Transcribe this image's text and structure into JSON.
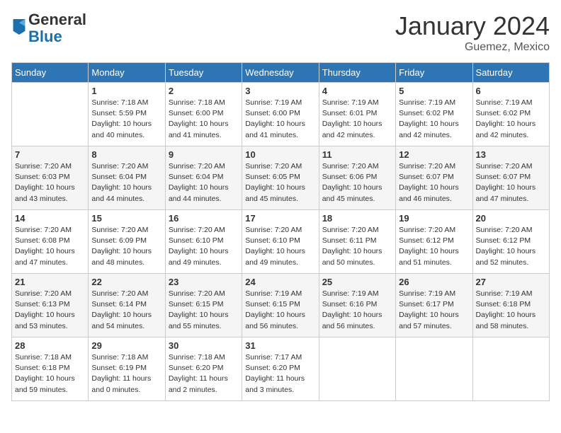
{
  "logo": {
    "general": "General",
    "blue": "Blue"
  },
  "header": {
    "month": "January 2024",
    "location": "Guemez, Mexico"
  },
  "weekdays": [
    "Sunday",
    "Monday",
    "Tuesday",
    "Wednesday",
    "Thursday",
    "Friday",
    "Saturday"
  ],
  "weeks": [
    [
      {
        "day": "",
        "detail": ""
      },
      {
        "day": "1",
        "detail": "Sunrise: 7:18 AM\nSunset: 5:59 PM\nDaylight: 10 hours\nand 40 minutes."
      },
      {
        "day": "2",
        "detail": "Sunrise: 7:18 AM\nSunset: 6:00 PM\nDaylight: 10 hours\nand 41 minutes."
      },
      {
        "day": "3",
        "detail": "Sunrise: 7:19 AM\nSunset: 6:00 PM\nDaylight: 10 hours\nand 41 minutes."
      },
      {
        "day": "4",
        "detail": "Sunrise: 7:19 AM\nSunset: 6:01 PM\nDaylight: 10 hours\nand 42 minutes."
      },
      {
        "day": "5",
        "detail": "Sunrise: 7:19 AM\nSunset: 6:02 PM\nDaylight: 10 hours\nand 42 minutes."
      },
      {
        "day": "6",
        "detail": "Sunrise: 7:19 AM\nSunset: 6:02 PM\nDaylight: 10 hours\nand 42 minutes."
      }
    ],
    [
      {
        "day": "7",
        "detail": "Sunrise: 7:20 AM\nSunset: 6:03 PM\nDaylight: 10 hours\nand 43 minutes."
      },
      {
        "day": "8",
        "detail": "Sunrise: 7:20 AM\nSunset: 6:04 PM\nDaylight: 10 hours\nand 44 minutes."
      },
      {
        "day": "9",
        "detail": "Sunrise: 7:20 AM\nSunset: 6:04 PM\nDaylight: 10 hours\nand 44 minutes."
      },
      {
        "day": "10",
        "detail": "Sunrise: 7:20 AM\nSunset: 6:05 PM\nDaylight: 10 hours\nand 45 minutes."
      },
      {
        "day": "11",
        "detail": "Sunrise: 7:20 AM\nSunset: 6:06 PM\nDaylight: 10 hours\nand 45 minutes."
      },
      {
        "day": "12",
        "detail": "Sunrise: 7:20 AM\nSunset: 6:07 PM\nDaylight: 10 hours\nand 46 minutes."
      },
      {
        "day": "13",
        "detail": "Sunrise: 7:20 AM\nSunset: 6:07 PM\nDaylight: 10 hours\nand 47 minutes."
      }
    ],
    [
      {
        "day": "14",
        "detail": "Sunrise: 7:20 AM\nSunset: 6:08 PM\nDaylight: 10 hours\nand 47 minutes."
      },
      {
        "day": "15",
        "detail": "Sunrise: 7:20 AM\nSunset: 6:09 PM\nDaylight: 10 hours\nand 48 minutes."
      },
      {
        "day": "16",
        "detail": "Sunrise: 7:20 AM\nSunset: 6:10 PM\nDaylight: 10 hours\nand 49 minutes."
      },
      {
        "day": "17",
        "detail": "Sunrise: 7:20 AM\nSunset: 6:10 PM\nDaylight: 10 hours\nand 49 minutes."
      },
      {
        "day": "18",
        "detail": "Sunrise: 7:20 AM\nSunset: 6:11 PM\nDaylight: 10 hours\nand 50 minutes."
      },
      {
        "day": "19",
        "detail": "Sunrise: 7:20 AM\nSunset: 6:12 PM\nDaylight: 10 hours\nand 51 minutes."
      },
      {
        "day": "20",
        "detail": "Sunrise: 7:20 AM\nSunset: 6:12 PM\nDaylight: 10 hours\nand 52 minutes."
      }
    ],
    [
      {
        "day": "21",
        "detail": "Sunrise: 7:20 AM\nSunset: 6:13 PM\nDaylight: 10 hours\nand 53 minutes."
      },
      {
        "day": "22",
        "detail": "Sunrise: 7:20 AM\nSunset: 6:14 PM\nDaylight: 10 hours\nand 54 minutes."
      },
      {
        "day": "23",
        "detail": "Sunrise: 7:20 AM\nSunset: 6:15 PM\nDaylight: 10 hours\nand 55 minutes."
      },
      {
        "day": "24",
        "detail": "Sunrise: 7:19 AM\nSunset: 6:15 PM\nDaylight: 10 hours\nand 56 minutes."
      },
      {
        "day": "25",
        "detail": "Sunrise: 7:19 AM\nSunset: 6:16 PM\nDaylight: 10 hours\nand 56 minutes."
      },
      {
        "day": "26",
        "detail": "Sunrise: 7:19 AM\nSunset: 6:17 PM\nDaylight: 10 hours\nand 57 minutes."
      },
      {
        "day": "27",
        "detail": "Sunrise: 7:19 AM\nSunset: 6:18 PM\nDaylight: 10 hours\nand 58 minutes."
      }
    ],
    [
      {
        "day": "28",
        "detail": "Sunrise: 7:18 AM\nSunset: 6:18 PM\nDaylight: 10 hours\nand 59 minutes."
      },
      {
        "day": "29",
        "detail": "Sunrise: 7:18 AM\nSunset: 6:19 PM\nDaylight: 11 hours\nand 0 minutes."
      },
      {
        "day": "30",
        "detail": "Sunrise: 7:18 AM\nSunset: 6:20 PM\nDaylight: 11 hours\nand 2 minutes."
      },
      {
        "day": "31",
        "detail": "Sunrise: 7:17 AM\nSunset: 6:20 PM\nDaylight: 11 hours\nand 3 minutes."
      },
      {
        "day": "",
        "detail": ""
      },
      {
        "day": "",
        "detail": ""
      },
      {
        "day": "",
        "detail": ""
      }
    ]
  ]
}
